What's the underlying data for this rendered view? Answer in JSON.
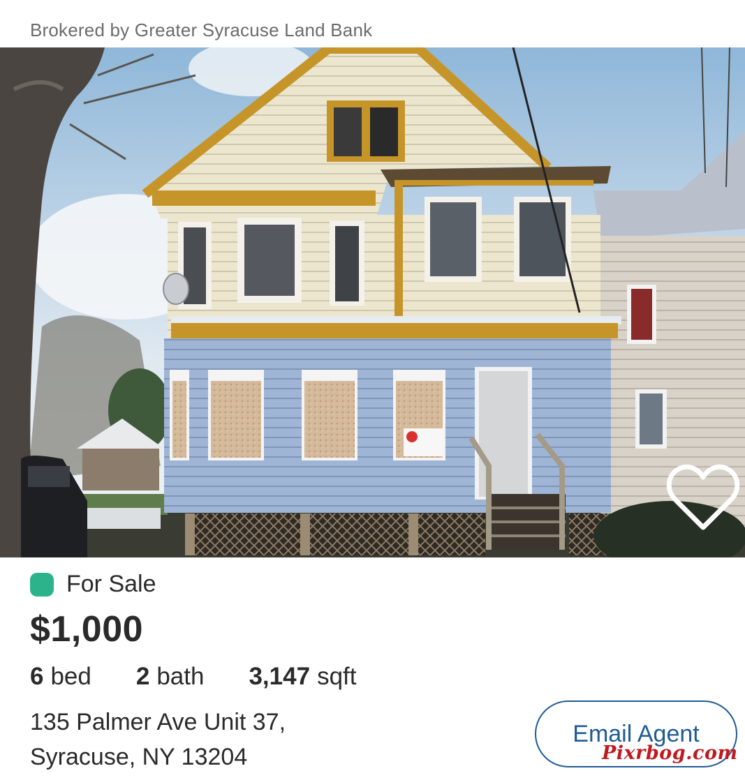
{
  "listing": {
    "broker_text": "Brokered by Greater Syracuse Land Bank",
    "status": "For Sale",
    "status_color": "#2bb38c",
    "price": "$1,000",
    "specs": [
      {
        "value": "6",
        "unit": "bed"
      },
      {
        "value": "2",
        "unit": "bath"
      },
      {
        "value": "3,147",
        "unit": "sqft"
      }
    ],
    "address_line1": "135 Palmer Ave Unit 37,",
    "address_line2": "Syracuse, NY 13204",
    "photo_icon": "house-photo",
    "favorite_icon": "heart-outline-icon"
  },
  "actions": {
    "email_label": "Email Agent",
    "accent_color": "#1f5a95"
  },
  "watermark": {
    "text": "Pixrbog.com"
  }
}
